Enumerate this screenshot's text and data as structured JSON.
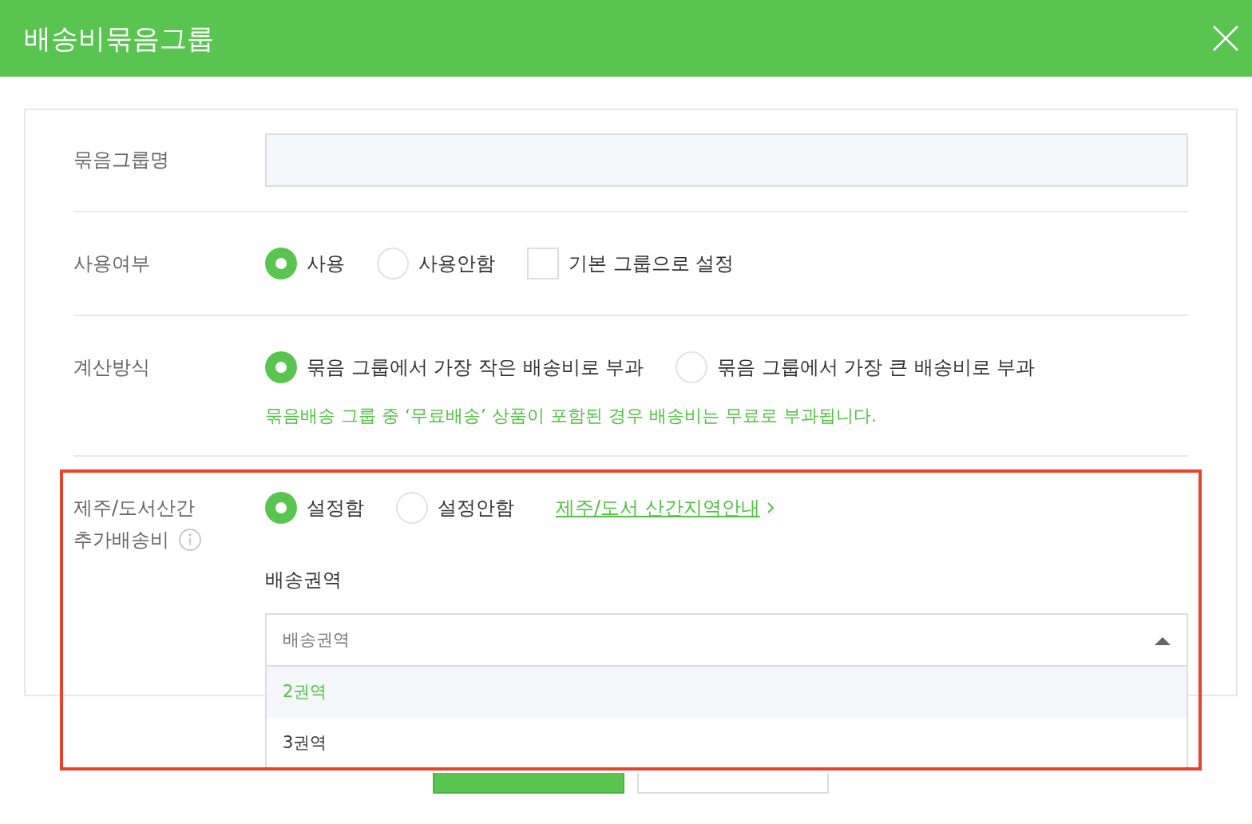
{
  "header": {
    "title": "배송비묶음그룹"
  },
  "group_name": {
    "label": "묶음그룹명"
  },
  "usage": {
    "label": "사용여부",
    "options": [
      {
        "label": "사용",
        "selected": true
      },
      {
        "label": "사용안함",
        "selected": false
      }
    ],
    "default_checkbox": {
      "label": "기본 그룹으로 설정",
      "checked": false
    }
  },
  "calculation": {
    "label": "계산방식",
    "options": [
      {
        "label": "묶음 그룹에서 가장 작은 배송비로 부과",
        "selected": true
      },
      {
        "label": "묶음 그룹에서 가장 큰 배송비로 부과",
        "selected": false
      }
    ],
    "note": "묶음배송 그룹 중 ‘무료배송’ 상품이 포함된 경우 배송비는 무료로 부과됩니다."
  },
  "remote_fee": {
    "label_lines": [
      "제주/도서산간",
      "추가배송비"
    ],
    "options": [
      {
        "label": "설정함",
        "selected": true
      },
      {
        "label": "설정안함",
        "selected": false
      }
    ],
    "link": "제주/도서 산간지역안내",
    "zone_label": "배송권역",
    "zone_select": {
      "placeholder": "배송권역",
      "expanded": true,
      "options": [
        {
          "label": "2권역",
          "selected": true
        },
        {
          "label": "3권역",
          "selected": false
        }
      ]
    }
  },
  "buttons": [
    {
      "kind": "primary"
    },
    {
      "kind": "secondary"
    }
  ]
}
